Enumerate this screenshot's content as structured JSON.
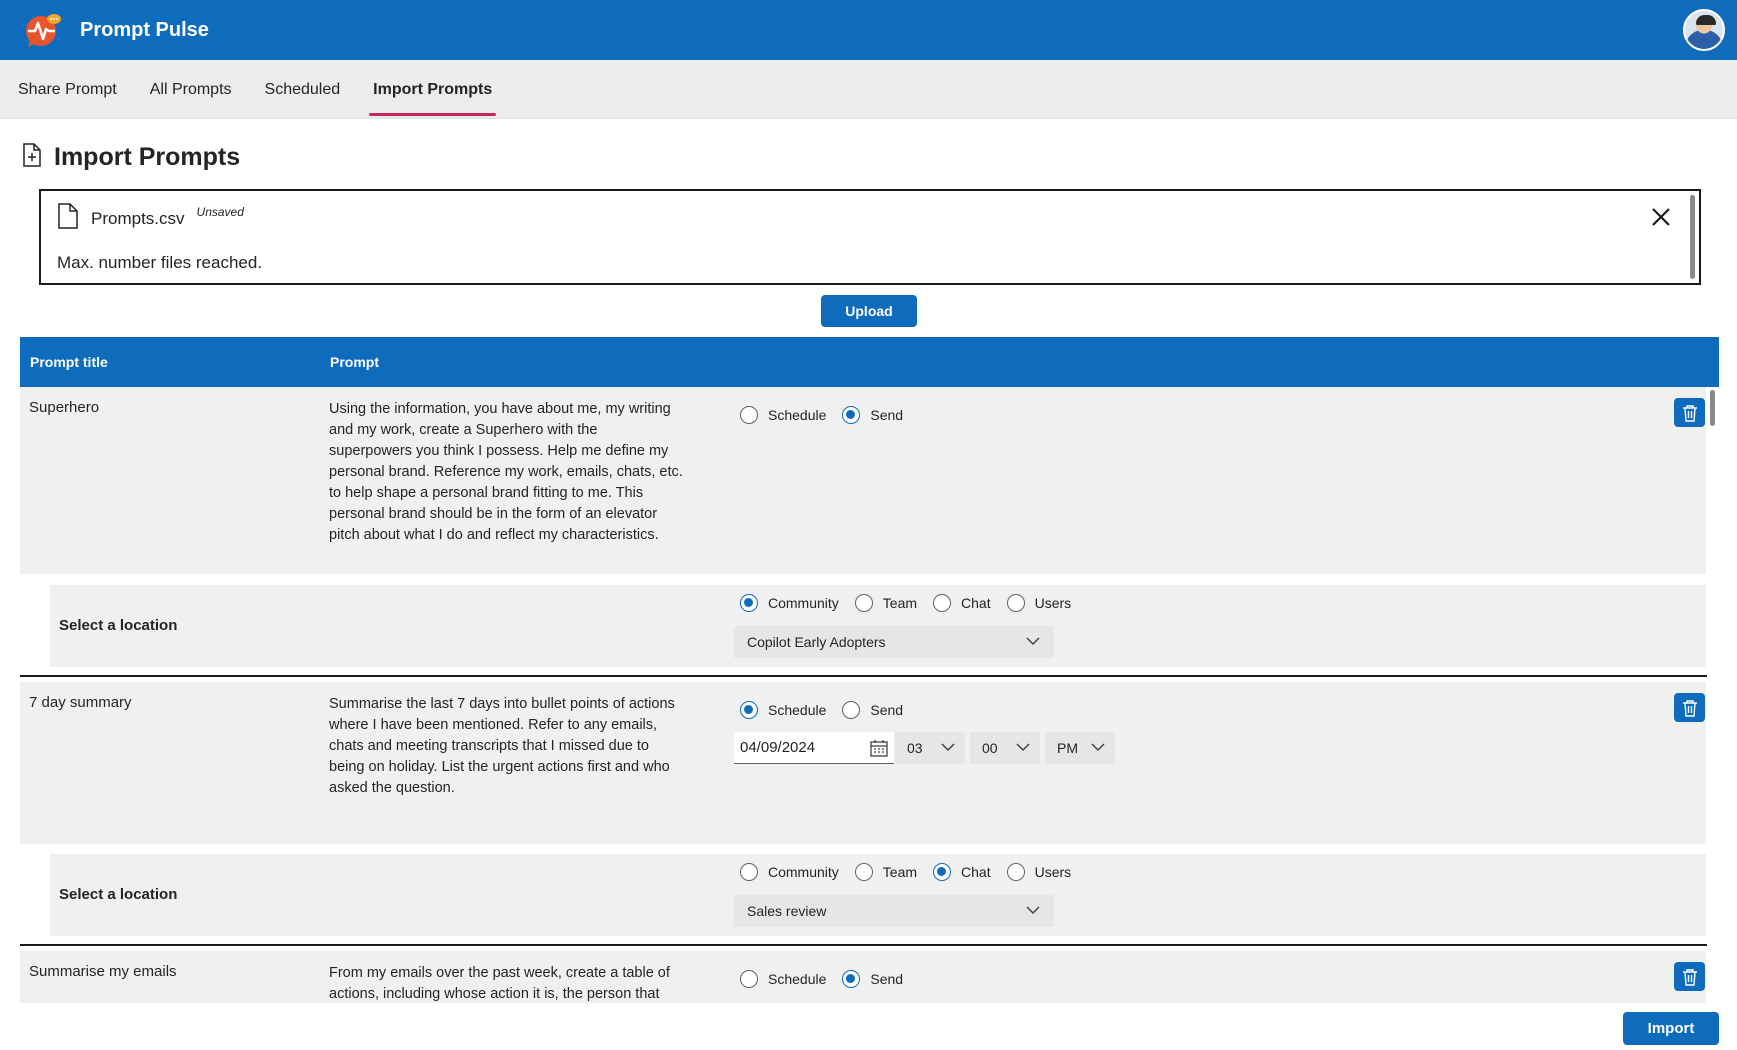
{
  "header": {
    "title": "Prompt Pulse",
    "logo_icon": "heartbeat-chat-icon",
    "avatar_icon": "user-avatar"
  },
  "tabs": [
    {
      "label": "Share Prompt",
      "active": false
    },
    {
      "label": "All Prompts",
      "active": false
    },
    {
      "label": "Scheduled",
      "active": false
    },
    {
      "label": "Import Prompts",
      "active": true
    }
  ],
  "page": {
    "title": "Import Prompts",
    "title_icon": "document-add-icon"
  },
  "file": {
    "name": "Prompts.csv",
    "status": "Unsaved",
    "message": "Max. number files reached."
  },
  "upload_label": "Upload",
  "table": {
    "headers": [
      "Prompt title",
      "Prompt"
    ],
    "rows": [
      {
        "title": "Superhero",
        "prompt": "Using the information, you have about me, my writing and my work, create a Superhero with the superpowers you think I possess. Help me define my personal brand. Reference my work, emails, chats, etc. to help shape a personal brand fitting to me. This personal brand should be in the form of an elevator pitch about what I do and reflect my characteristics.",
        "mode_options": [
          "Schedule",
          "Send"
        ],
        "mode": "Send",
        "location_label": "Select a location",
        "location_options": [
          "Community",
          "Team",
          "Chat",
          "Users"
        ],
        "location": "Community",
        "location_value": "Copilot Early Adopters"
      },
      {
        "title": "7 day summary",
        "prompt": "Summarise the last 7 days into bullet points of actions where I have been mentioned. Refer to any emails, chats and meeting transcripts that I missed due to being on holiday. List the urgent actions first and who asked the question.",
        "mode_options": [
          "Schedule",
          "Send"
        ],
        "mode": "Schedule",
        "date": "04/09/2024",
        "hour": "03",
        "minute": "00",
        "ampm": "PM",
        "location_label": "Select a location",
        "location_options": [
          "Community",
          "Team",
          "Chat",
          "Users"
        ],
        "location": "Chat",
        "location_value": "Sales review"
      },
      {
        "title": "Summarise my emails",
        "prompt": "From my emails over the past week, create a table of actions, including whose action it is, the person that",
        "mode_options": [
          "Schedule",
          "Send"
        ],
        "mode": "Send"
      }
    ]
  },
  "import_label": "Import",
  "colors": {
    "brand": "#0f6cbd",
    "tab_indicator": "#c22a5a",
    "row_bg": "#f0f0f0"
  }
}
